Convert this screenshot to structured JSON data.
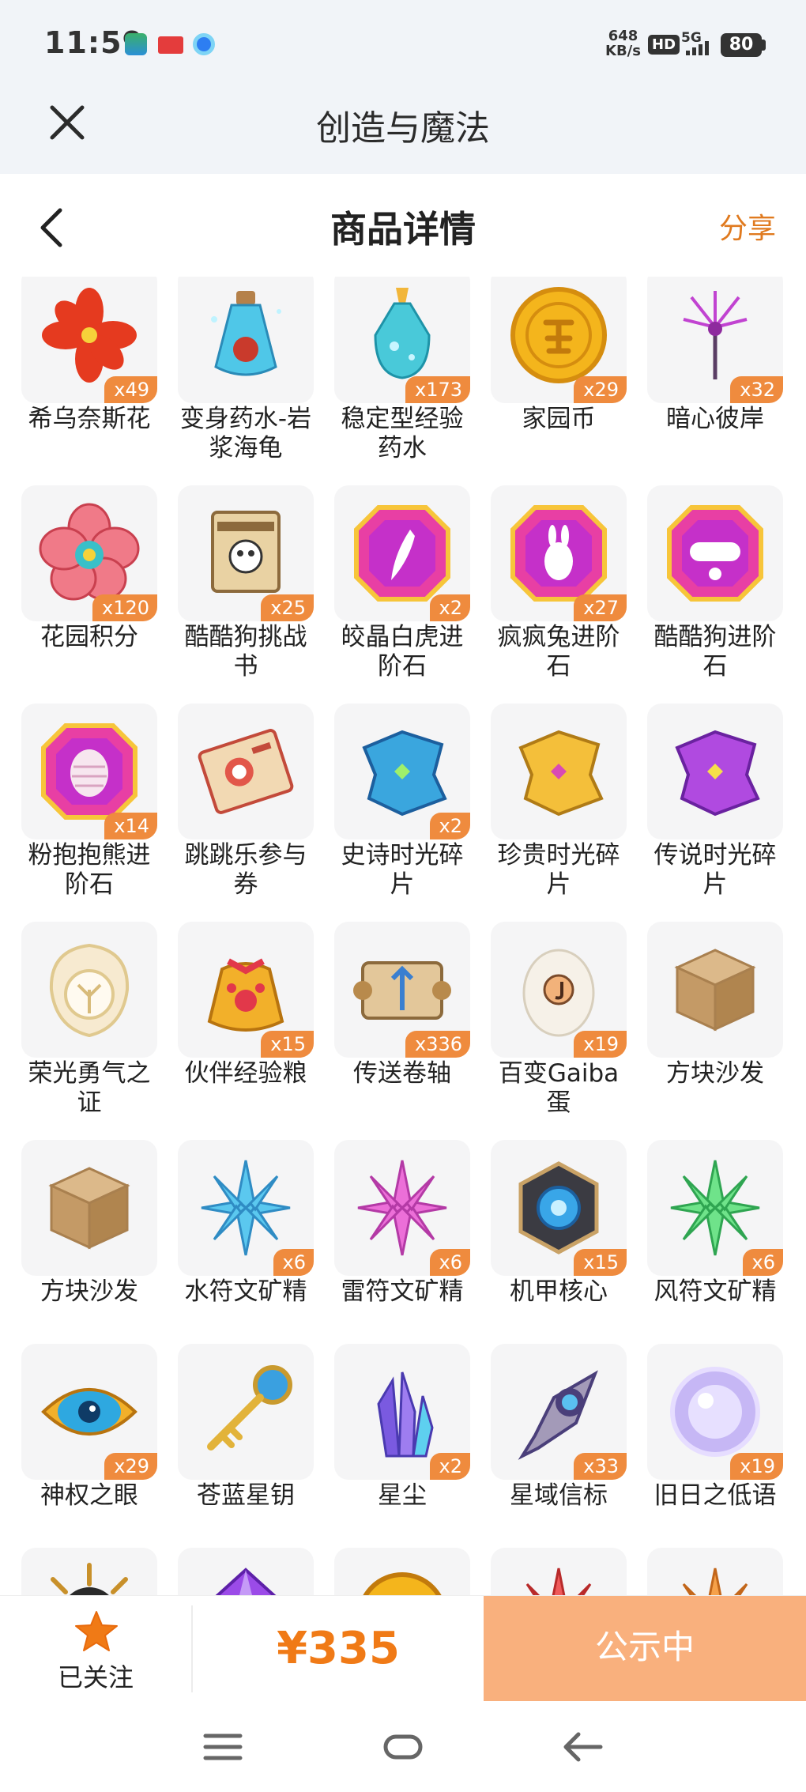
{
  "status_bar": {
    "time": "11:59",
    "net_speed_value": "648",
    "net_speed_unit": "KB/s",
    "hd": "HD",
    "network": "5G",
    "battery": "80"
  },
  "app_bar": {
    "title": "创造与魔法"
  },
  "page_header": {
    "title": "商品详情",
    "share_label": "分享"
  },
  "items": [
    {
      "name": "希乌奈斯花",
      "count": "x49",
      "icon": "red-flower-icon"
    },
    {
      "name": "变身药水-岩浆海龟",
      "count": "",
      "icon": "potion-bottle-icon"
    },
    {
      "name": "稳定型经验药水",
      "count": "x173",
      "icon": "exp-potion-icon"
    },
    {
      "name": "家园币",
      "count": "x29",
      "icon": "gold-coin-icon"
    },
    {
      "name": "暗心彼岸",
      "count": "x32",
      "icon": "purple-flower-icon"
    },
    {
      "name": "花园积分",
      "count": "x120",
      "icon": "pink-flower-badge-icon"
    },
    {
      "name": "酷酷狗挑战书",
      "count": "x25",
      "icon": "wanted-scroll-icon"
    },
    {
      "name": "皎晶白虎进阶石",
      "count": "x2",
      "icon": "gem-claw-icon"
    },
    {
      "name": "疯疯兔进阶石",
      "count": "x27",
      "icon": "gem-rabbit-icon"
    },
    {
      "name": "酷酷狗进阶石",
      "count": "",
      "icon": "gem-goggles-icon"
    },
    {
      "name": "粉抱抱熊进阶石",
      "count": "x14",
      "icon": "gem-egg-icon"
    },
    {
      "name": "跳跳乐参与券",
      "count": "",
      "icon": "ticket-icon"
    },
    {
      "name": "史诗时光碎片",
      "count": "x2",
      "icon": "blue-fragment-icon"
    },
    {
      "name": "珍贵时光碎片",
      "count": "",
      "icon": "gold-fragment-icon"
    },
    {
      "name": "传说时光碎片",
      "count": "",
      "icon": "purple-fragment-icon"
    },
    {
      "name": "荣光勇气之证",
      "count": "",
      "icon": "tree-emblem-icon"
    },
    {
      "name": "伙伴经验粮",
      "count": "x15",
      "icon": "food-sack-icon"
    },
    {
      "name": "传送卷轴",
      "count": "x336",
      "icon": "teleport-scroll-icon"
    },
    {
      "name": "百变Gaiba蛋",
      "count": "x19",
      "icon": "egg-icon"
    },
    {
      "name": "方块沙发",
      "count": "",
      "icon": "wood-cube-icon"
    },
    {
      "name": "方块沙发",
      "count": "",
      "icon": "wood-cube-icon"
    },
    {
      "name": "水符文矿精",
      "count": "x6",
      "icon": "blue-crystal-icon"
    },
    {
      "name": "雷符文矿精",
      "count": "x6",
      "icon": "pink-crystal-icon"
    },
    {
      "name": "机甲核心",
      "count": "x15",
      "icon": "mech-core-icon"
    },
    {
      "name": "风符文矿精",
      "count": "x6",
      "icon": "green-crystal-icon"
    },
    {
      "name": "神权之眼",
      "count": "x29",
      "icon": "eye-emblem-icon"
    },
    {
      "name": "苍蓝星钥",
      "count": "",
      "icon": "key-icon"
    },
    {
      "name": "星尘",
      "count": "x2",
      "icon": "stardust-crystal-icon"
    },
    {
      "name": "星域信标",
      "count": "x33",
      "icon": "beacon-icon"
    },
    {
      "name": "旧日之低语",
      "count": "x19",
      "icon": "orb-icon"
    },
    {
      "name": "",
      "count": "",
      "icon": "dark-sun-icon"
    },
    {
      "name": "",
      "count": "",
      "icon": "violet-gem-icon"
    },
    {
      "name": "",
      "count": "",
      "icon": "gold-medal-icon"
    },
    {
      "name": "",
      "count": "",
      "icon": "red-crystal-icon"
    },
    {
      "name": "",
      "count": "",
      "icon": "orange-crystal-icon"
    }
  ],
  "bottom_bar": {
    "follow_label": "已关注",
    "price": "¥335",
    "status_button": "公示中"
  },
  "colors": {
    "accent": "#f07a16",
    "badge": "#ef8b3e",
    "status_button": "#f9b07d"
  }
}
